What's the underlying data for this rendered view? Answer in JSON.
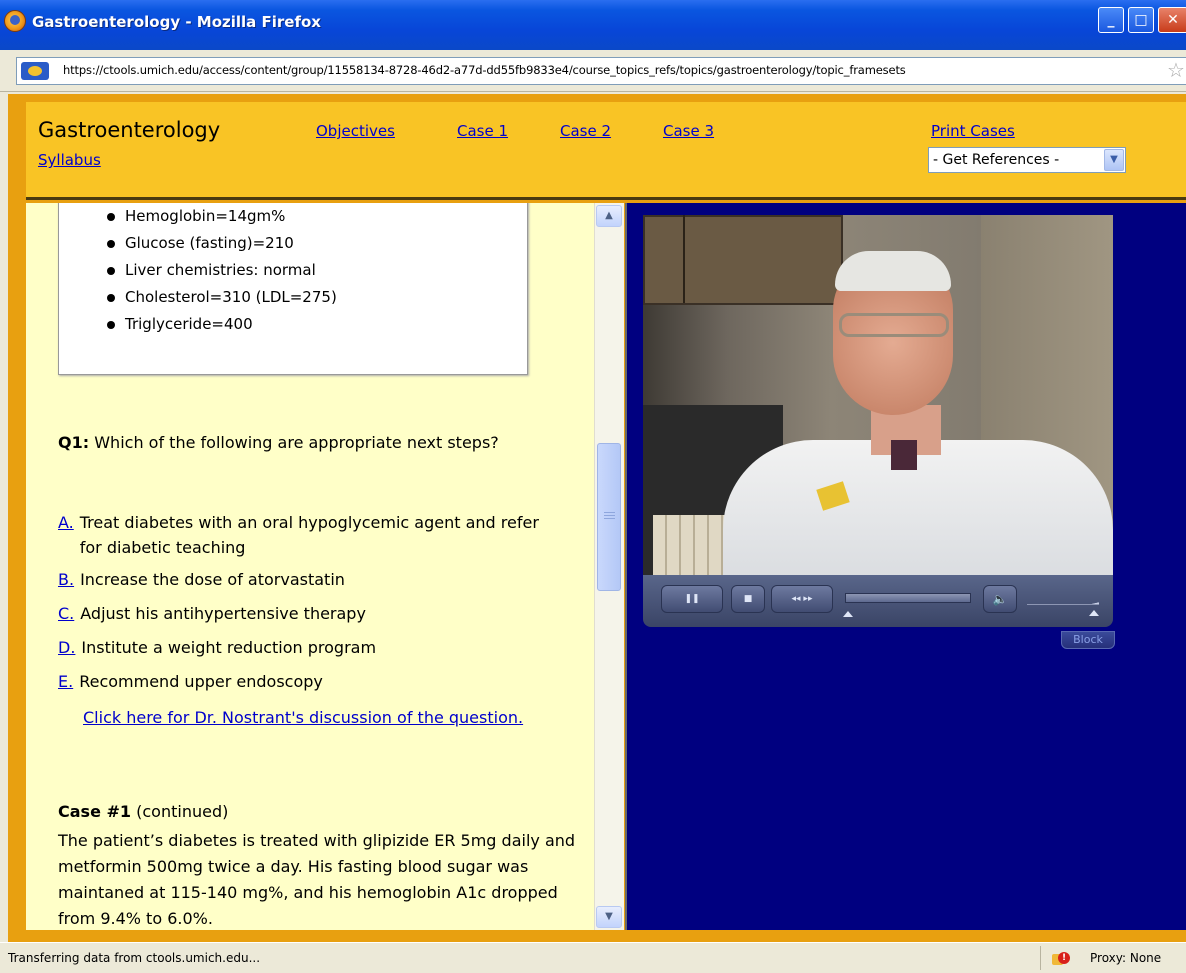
{
  "window": {
    "title": "Gastroenterology - Mozilla Firefox",
    "minimize_label": "_",
    "maximize_label": "□",
    "close_label": "✕"
  },
  "address_bar": {
    "url": "https://ctools.umich.edu/access/content/group/11558134-8728-46d2-a77d-dd55fb9833e4/course_topics_refs/topics/gastroenterology/topic_framesets"
  },
  "top_nav": {
    "course_title": "Gastroenterology",
    "syllabus": "Syllabus",
    "links": [
      "Objectives",
      "Case 1",
      "Case 2",
      "Case 3"
    ],
    "print_cases": "Print Cases",
    "references_select": "- Get References -"
  },
  "lab_results": [
    "Hemoglobin=14gm%",
    "Glucose (fasting)=210",
    "Liver chemistries: normal",
    "Cholesterol=310 (LDL=275)",
    "Triglyceride=400"
  ],
  "question": {
    "label": "Q1:",
    "text": "Which of the following are appropriate next steps?"
  },
  "options": [
    {
      "letter": "A.",
      "text": "Treat diabetes with an oral hypoglycemic agent and refer for diabetic teaching"
    },
    {
      "letter": "B.",
      "text": "Increase the dose of atorvastatin"
    },
    {
      "letter": "C.",
      "text": "Adjust his antihypertensive therapy"
    },
    {
      "letter": "D.",
      "text": "Institute a weight reduction program"
    },
    {
      "letter": "E.",
      "text": "Recommend upper endoscopy"
    }
  ],
  "discussion_link": "Click here for Dr. Nostrant's discussion of the question.",
  "case": {
    "title": "Case #1",
    "suffix": "(continued)",
    "body": "The patient’s diabetes is treated with glipizide ER 5mg daily and metformin 500mg twice a day. His fasting blood sugar was maintaned at 115-140 mg%, and his hemoglobin A1c dropped from 9.4% to 6.0%."
  },
  "video_player": {
    "pause_glyph": "❚❚",
    "stop_glyph": "■",
    "seek_glyph": "◂◂ ▸▸",
    "volume_glyph": "🔈",
    "block_label": "Block"
  },
  "status_bar": {
    "message": "Transferring data from ctools.umich.edu...",
    "proxy": "Proxy: None"
  },
  "icons": {
    "browser": "firefox-icon",
    "site": "site-favicon",
    "bookmark": "star-icon",
    "scroll_up": "chevron-up-icon",
    "scroll_down": "chevron-down-icon",
    "dropdown": "chevron-down-icon",
    "security": "warning-icon"
  }
}
